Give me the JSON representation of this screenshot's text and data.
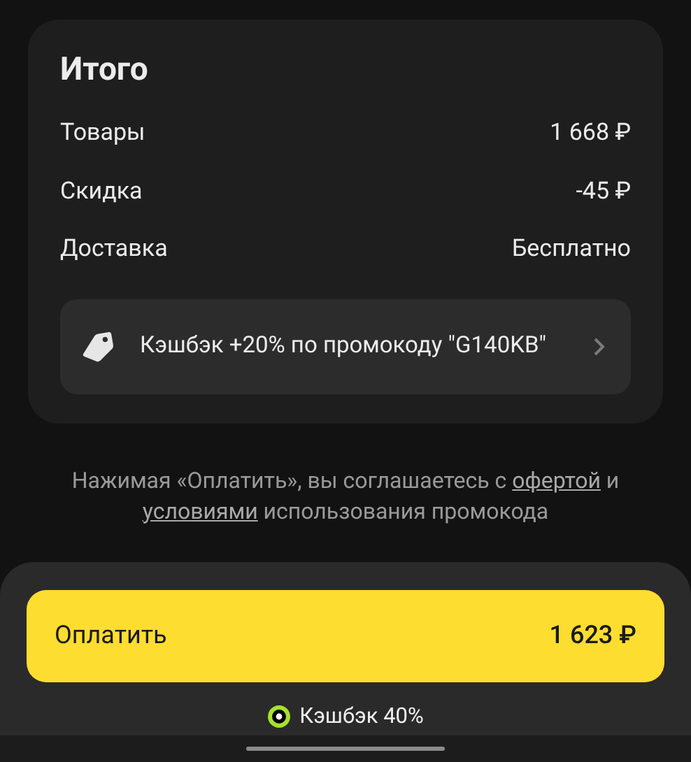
{
  "summary": {
    "title": "Итого",
    "rows": [
      {
        "label": "Товары",
        "value": "1 668 ₽"
      },
      {
        "label": "Скидка",
        "value": "-45 ₽"
      },
      {
        "label": "Доставка",
        "value": "Бесплатно"
      }
    ],
    "promo": {
      "text": "Кэшбэк +20% по промокоду \"G140KB\""
    }
  },
  "legal": [
    {
      "kind": "text",
      "text": "Нажимая «Оплатить», вы соглашаетесь с"
    },
    {
      "kind": "link",
      "text": "офертой"
    },
    {
      "kind": "text",
      "text": "и"
    },
    {
      "kind": "link",
      "text": "условиями"
    },
    {
      "kind": "text",
      "text": "использования промокода"
    }
  ],
  "pay_button": {
    "label": "Оплатить",
    "amount": "1 623 ₽"
  },
  "cashback": {
    "text": "Кэшбэк 40%"
  }
}
